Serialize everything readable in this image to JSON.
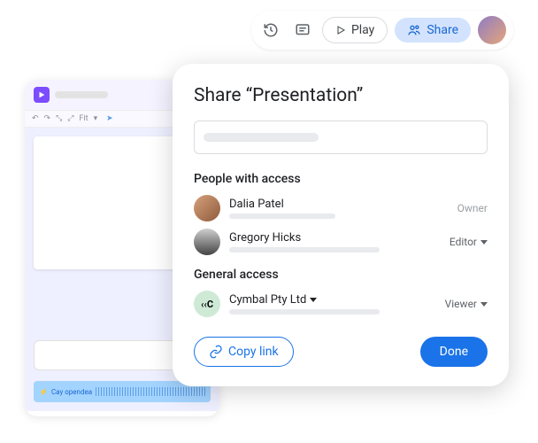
{
  "toolbar": {
    "play_label": "Play",
    "share_label": "Share"
  },
  "doc": {
    "audio_label": "Cay opendea",
    "toolbar_fit": "Fit"
  },
  "share": {
    "title": "Share “Presentation”",
    "people_header": "People with access",
    "general_header": "General access",
    "people": [
      {
        "name": "Dalia Patel",
        "role": "Owner"
      },
      {
        "name": "Gregory Hicks",
        "role": "Editor"
      }
    ],
    "org": {
      "name": "Cymbal Pty Ltd",
      "role": "Viewer",
      "badge": "‹‹C"
    },
    "copy_link_label": "Copy link",
    "done_label": "Done"
  }
}
